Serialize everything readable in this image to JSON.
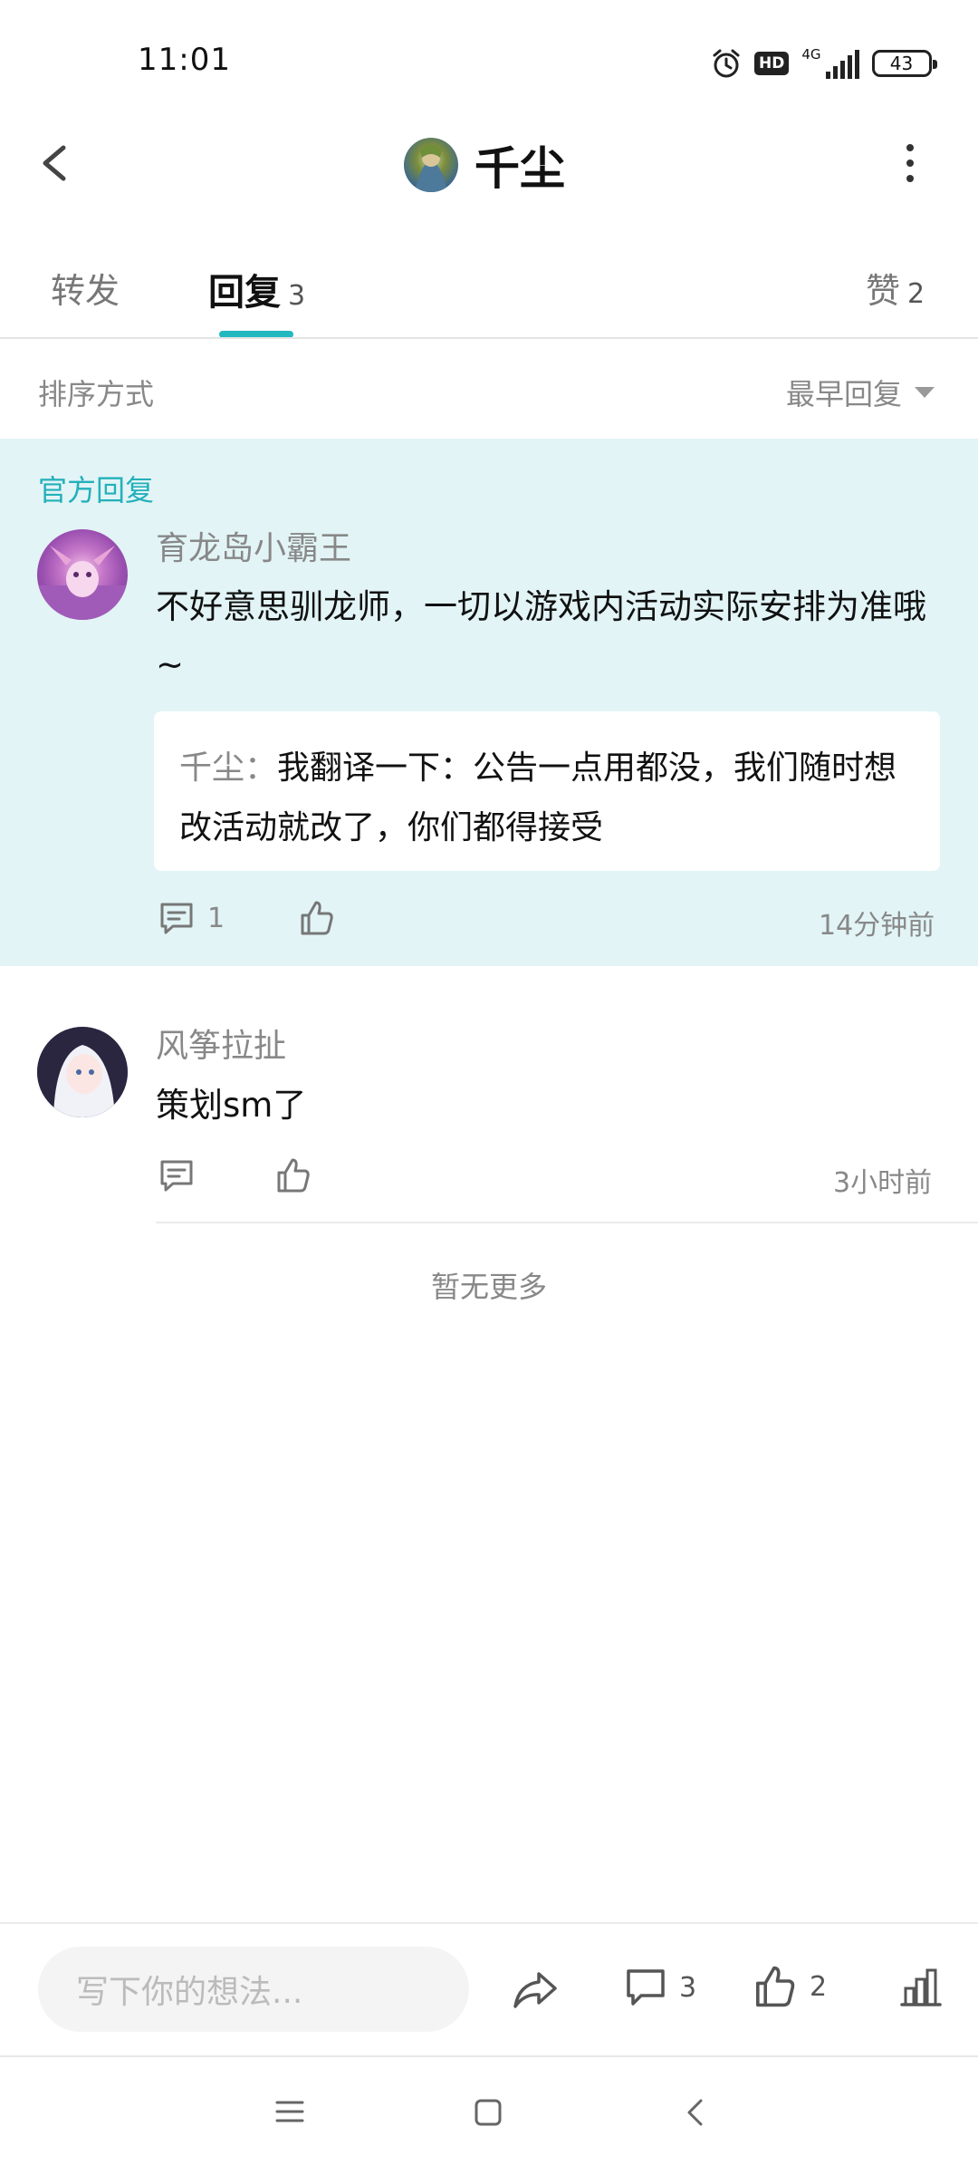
{
  "status_bar": {
    "time": "11:01",
    "hd": "HD",
    "network": "4G",
    "battery": "43"
  },
  "header": {
    "title": "千尘",
    "back_icon": "chevron-left-icon",
    "more_icon": "more-vertical-icon"
  },
  "tabs": [
    {
      "label": "转发",
      "count": ""
    },
    {
      "label": "回复",
      "count": "3",
      "active": true
    },
    {
      "label": "赞",
      "count": "2"
    }
  ],
  "sort": {
    "label": "排序方式",
    "value": "最早回复"
  },
  "official_reply": {
    "badge": "官方回复",
    "author": "育龙岛小霸王",
    "text": "不好意思驯龙师，一切以游戏内活动实际安排为准哦~",
    "quote": {
      "author": "千尘",
      "separator": "：",
      "text": "我翻译一下：公告一点用都没，我们随时想改活动就改了，你们都得接受"
    },
    "comment_count": "1",
    "time": "14分钟前"
  },
  "reply": {
    "author": "风筝拉扯",
    "text": "策划sm了",
    "time": "3小时前"
  },
  "footer_note": "暂无更多",
  "bottom_bar": {
    "input_placeholder": "写下你的想法...",
    "comment_count": "3",
    "like_count": "2"
  },
  "colors": {
    "accent": "#23b8c0",
    "official_bg": "#e2f4f6"
  }
}
